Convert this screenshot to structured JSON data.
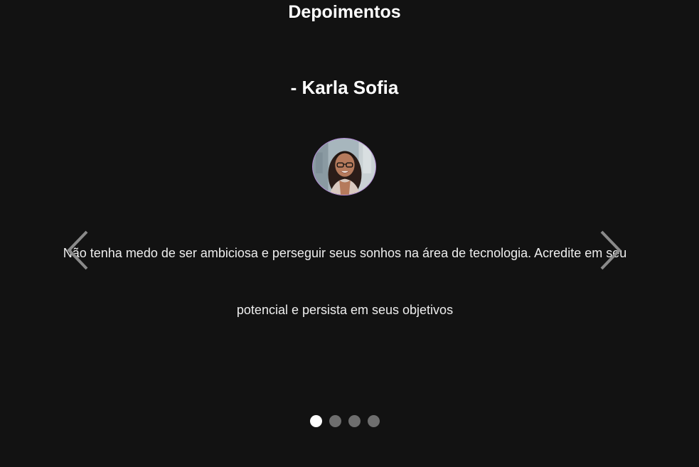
{
  "section": {
    "title": "Depoimentos"
  },
  "testimonial": {
    "author": "- Karla Sofia",
    "avatar_alt": "Karla Sofia",
    "quote": "Não tenha medo de ser ambiciosa e perseguir seus sonhos na área de tecnologia. Acredite em seu potencial e persista em seus objetivos"
  },
  "carousel": {
    "prev_icon": "chevron-left-icon",
    "next_icon": "chevron-right-icon",
    "slide_count": 4,
    "active_index": 0
  },
  "colors": {
    "background": "#121212",
    "text": "#ffffff",
    "indicator_active": "#ffffff",
    "indicator_inactive": "#6e6e6e",
    "avatar_border": "#b58ad8"
  }
}
